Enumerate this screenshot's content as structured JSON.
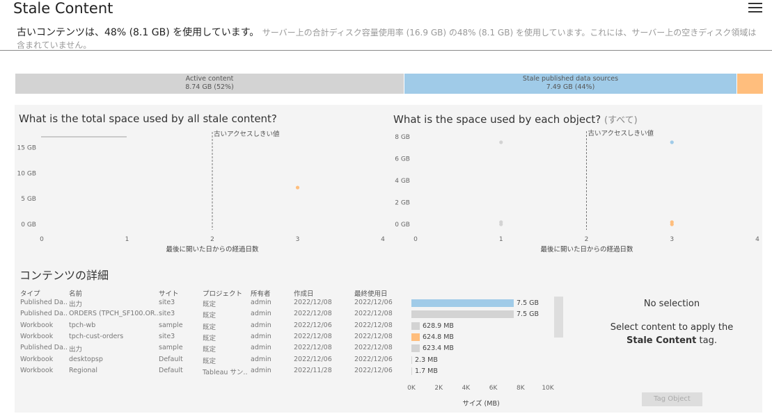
{
  "page": {
    "title": "Stale Content",
    "summary_main": "古いコンテンツは、48% (8.1 GB) を使用しています。",
    "summary_sub": "サーバー上の合計ディスク容量使用率 (16.9 GB) の48% (8.1 GB) を使用しています。これには、サーバー上の空きディスク領域は含まれていません。"
  },
  "usage_bar": {
    "segments": [
      {
        "label": "Active content",
        "value": "8.74 GB (52%)",
        "color": "#d3d3d3",
        "fraction": 0.52
      },
      {
        "label": "Stale published data sources",
        "value": "7.49 GB (44%)",
        "color": "#a0cbe8",
        "fraction": 0.445
      },
      {
        "label": "",
        "value": "",
        "color": "#ffbe7d",
        "fraction": 0.035
      }
    ]
  },
  "chart_left": {
    "title": "What is the total space used by all stale content?",
    "threshold_label": "古いアクセスしきい値",
    "xlabel": "最後に開いた日からの経過日数",
    "y_ticks": [
      "15 GB",
      "10 GB",
      "5 GB",
      "0 GB"
    ],
    "x_ticks": [
      "0",
      "1",
      "2",
      "3",
      "4"
    ]
  },
  "chart_right": {
    "title": "What is the space used by each object?",
    "title_suffix": "(すべて)",
    "threshold_label": "古いアクセスしきい値",
    "xlabel": "最後に開いた日からの経過日数",
    "y_ticks": [
      "8 GB",
      "6 GB",
      "4 GB",
      "2 GB",
      "0 GB"
    ],
    "x_ticks": [
      "0",
      "1",
      "2",
      "3",
      "4"
    ]
  },
  "chart_data": [
    {
      "type": "scatter",
      "title": "What is the total space used by all stale content?",
      "xlabel": "最後に開いた日からの経過日数",
      "ylabel": "",
      "xlim": [
        0,
        4
      ],
      "ylim": [
        0,
        17
      ],
      "threshold_x": 2,
      "series": [
        {
          "color": "#ffbe7d",
          "points": [
            {
              "x": 3,
              "y": 7.2
            }
          ]
        }
      ]
    },
    {
      "type": "scatter",
      "title": "What is the space used by each object?",
      "xlabel": "最後に開いた日からの経過日数",
      "ylabel": "",
      "xlim": [
        0,
        4
      ],
      "ylim": [
        0,
        8
      ],
      "threshold_x": 2,
      "series": [
        {
          "color": "#a0cbe8",
          "points": [
            {
              "x": 3,
              "y": 7.5
            }
          ]
        },
        {
          "color": "#d3d3d3",
          "points": [
            {
              "x": 1,
              "y": 7.5
            },
            {
              "x": 1,
              "y": 0.2
            },
            {
              "x": 1,
              "y": 0.0
            }
          ]
        },
        {
          "color": "#ffbe7d",
          "points": [
            {
              "x": 3,
              "y": 0.2
            },
            {
              "x": 3,
              "y": 0.0
            }
          ]
        }
      ]
    },
    {
      "type": "bar",
      "xlabel": "サイズ (MB)",
      "x_ticks": [
        "0K",
        "2K",
        "4K",
        "6K",
        "8K",
        "10K"
      ],
      "xlim": [
        0,
        10000
      ],
      "categories": [
        "出力",
        "ORDERS (TPCH_SF100.OR..",
        "tpch-wb",
        "tpch-cust-orders",
        "出力",
        "desktopsp",
        "Regional"
      ],
      "values": [
        7500,
        7500,
        628.9,
        624.8,
        623.4,
        2.3,
        1.7
      ],
      "colors": [
        "#a0cbe8",
        "#d3d3d3",
        "#d3d3d3",
        "#ffbe7d",
        "#d3d3d3",
        "#d3d3d3",
        "#d3d3d3"
      ]
    }
  ],
  "details": {
    "title": "コンテンツの詳細",
    "columns": [
      "タイプ",
      "名前",
      "サイト",
      "プロジェクト",
      "所有者",
      "作成日",
      "最終使用日"
    ],
    "rows": [
      {
        "type": "Published Da..",
        "name": "出力",
        "site": "site3",
        "project": "既定",
        "owner": "admin",
        "created": "2022/12/08",
        "last_used": "2022/12/06",
        "size_label": "7.5 GB"
      },
      {
        "type": "Published Da..",
        "name": "ORDERS (TPCH_SF100.OR..",
        "site": "site3",
        "project": "既定",
        "owner": "admin",
        "created": "2022/12/08",
        "last_used": "2022/12/08",
        "size_label": "7.5 GB"
      },
      {
        "type": "Workbook",
        "name": "tpch-wb",
        "site": "sample",
        "project": "既定",
        "owner": "admin",
        "created": "2022/12/06",
        "last_used": "2022/12/08",
        "size_label": "628.9 MB"
      },
      {
        "type": "Workbook",
        "name": "tpch-cust-orders",
        "site": "site3",
        "project": "既定",
        "owner": "admin",
        "created": "2022/12/08",
        "last_used": "2022/12/08",
        "size_label": "624.8 MB"
      },
      {
        "type": "Published Da..",
        "name": "出力",
        "site": "sample",
        "project": "既定",
        "owner": "admin",
        "created": "2022/12/08",
        "last_used": "2022/12/08",
        "size_label": "623.4 MB"
      },
      {
        "type": "Workbook",
        "name": "desktopsp",
        "site": "Default",
        "project": "既定",
        "owner": "admin",
        "created": "2022/12/06",
        "last_used": "2022/12/06",
        "size_label": "2.3 MB"
      },
      {
        "type": "Workbook",
        "name": "Regional",
        "site": "Default",
        "project": "Tableau サン..",
        "owner": "admin",
        "created": "2022/11/28",
        "last_used": "2022/12/06",
        "size_label": "1.7 MB"
      }
    ]
  },
  "side": {
    "no_selection": "No selection",
    "apply_text": "Select content to apply the",
    "tag_name": "Stale Content",
    "tag_suffix": "tag.",
    "tag_button": "Tag Object"
  }
}
